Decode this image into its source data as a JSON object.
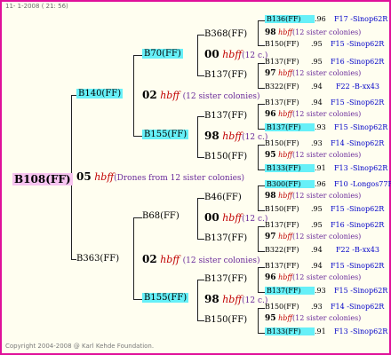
{
  "header": {
    "code": "11-",
    "timestamp": "1-2008 ( 21: 56)"
  },
  "footer": "Copyright 2004-2008 @ Karl Kehde Foundation.",
  "mark": "hbff",
  "colonies": "(12 sister colonies)",
  "colonies_short": "(12 c.)",
  "colors": {
    "border": "#e0109a",
    "cyan": "#66f0f8",
    "pink": "#f7c4f0",
    "mark": "#c00000",
    "paren": "#6a2a9a",
    "desc": "#0000c8"
  },
  "root": {
    "id": "B108(FF)",
    "gen": "05",
    "note": "(Drones from 12 sister colonies)"
  },
  "l1": [
    {
      "id": "B140(FF)",
      "gen": "02",
      "note": "(12 sister colonies)"
    },
    {
      "id": "B363(FF)",
      "gen": "02",
      "note": "(12 sister colonies)"
    }
  ],
  "l2": [
    {
      "id": "B70(FF)",
      "gen": "00",
      "note": "(12 c.)"
    },
    {
      "id": "B155(FF)",
      "gen": "98",
      "note": "(12 c.)"
    },
    {
      "id": "B68(FF)",
      "gen": "00",
      "note": "(12 c.)"
    },
    {
      "id": "B155(FF)",
      "gen": "98",
      "note": "(12 c.)"
    }
  ],
  "l3": [
    {
      "id": "B368(FF)",
      "gen": "98",
      "note": "(12 sister colonies)"
    },
    {
      "id": "B137(FF)",
      "gen": "97",
      "note": "(12 sister colonies)"
    },
    {
      "id": "B137(FF)",
      "gen": "96",
      "note": "(12 sister colonies)"
    },
    {
      "id": "B150(FF)",
      "gen": "95",
      "note": "(12 sister colonies)"
    },
    {
      "id": "B46(FF)",
      "gen": "98",
      "note": "(12 sister colonies)"
    },
    {
      "id": "B137(FF)",
      "gen": "97",
      "note": "(12 sister colonies)"
    },
    {
      "id": "B137(FF)",
      "gen": "96",
      "note": "(12 sister colonies)"
    },
    {
      "id": "B150(FF)",
      "gen": "95",
      "note": "(12 sister colonies)"
    }
  ],
  "l4": [
    {
      "id": "B136(FF)",
      "q": ".96",
      "desc": "F17 -Sinop62R"
    },
    {
      "id": "B150(FF)",
      "q": ".95",
      "desc": "F15 -Sinop62R"
    },
    {
      "id": "B137(FF)",
      "q": ".95",
      "desc": "F16 -Sinop62R"
    },
    {
      "id": "B322(FF)",
      "q": ".94",
      "desc": "F22 -B-xx43"
    },
    {
      "id": "B137(FF)",
      "q": ".94",
      "desc": "F15 -Sinop62R"
    },
    {
      "id": "B137(FF)",
      "q": ".93",
      "desc": "F15 -Sinop62R"
    },
    {
      "id": "B150(FF)",
      "q": ".93",
      "desc": "F14 -Sinop62R"
    },
    {
      "id": "B133(FF)",
      "q": ".91",
      "desc": "F13 -Sinop62R"
    },
    {
      "id": "B300(FF)",
      "q": ".96",
      "desc": "F10 -Longos77R"
    },
    {
      "id": "B150(FF)",
      "q": ".95",
      "desc": "F15 -Sinop62R"
    },
    {
      "id": "B137(FF)",
      "q": ".95",
      "desc": "F16 -Sinop62R"
    },
    {
      "id": "B322(FF)",
      "q": ".94",
      "desc": "F22 -B-xx43"
    },
    {
      "id": "B137(FF)",
      "q": ".94",
      "desc": "F15 -Sinop62R"
    },
    {
      "id": "B137(FF)",
      "q": ".93",
      "desc": "F15 -Sinop62R"
    },
    {
      "id": "B150(FF)",
      "q": ".93",
      "desc": "F14 -Sinop62R"
    },
    {
      "id": "B133(FF)",
      "q": ".91",
      "desc": "F13 -Sinop62R"
    }
  ]
}
